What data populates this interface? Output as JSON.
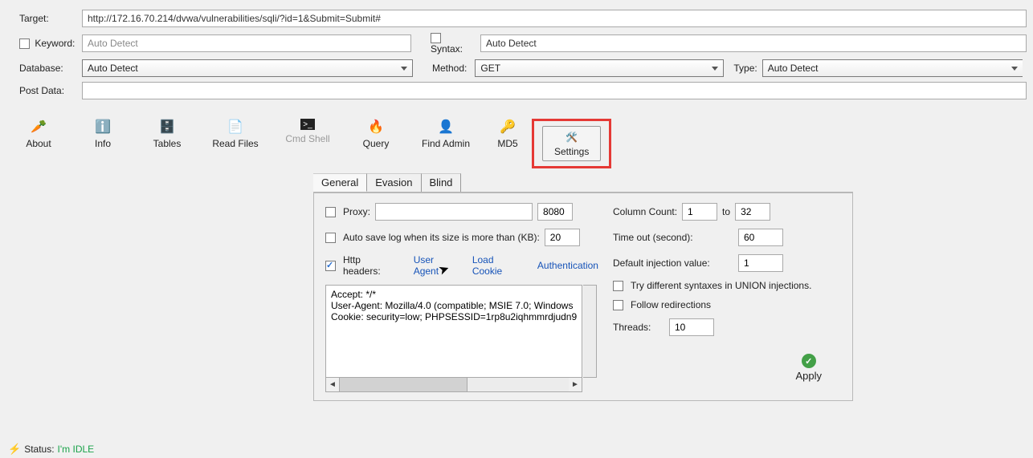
{
  "top": {
    "target_label": "Target:",
    "target_value": "http://172.16.70.214/dvwa/vulnerabilities/sqli/?id=1&Submit=Submit#",
    "keyword_label": "Keyword:",
    "keyword_value": "Auto Detect",
    "syntax_label": "Syntax:",
    "syntax_value": "Auto Detect",
    "database_label": "Database:",
    "database_value": "Auto Detect",
    "method_label": "Method:",
    "method_value": "GET",
    "type_label": "Type:",
    "type_value": "Auto Detect",
    "post_data_label": "Post Data:",
    "post_data_value": ""
  },
  "toolbar": {
    "about": "About",
    "info": "Info",
    "tables": "Tables",
    "read_files": "Read Files",
    "cmd_shell": "Cmd Shell",
    "query": "Query",
    "find_admin": "Find Admin",
    "md5": "MD5",
    "settings": "Settings"
  },
  "tabs": {
    "general": "General",
    "evasion": "Evasion",
    "blind": "Blind"
  },
  "general": {
    "proxy_label": "Proxy:",
    "proxy_host": "",
    "proxy_port": "8080",
    "autosave_label": "Auto save log when its size is more than (KB):",
    "autosave_value": "20",
    "headers_label": "Http headers:",
    "link_user_agent": "User Agent",
    "link_load_cookie": "Load Cookie",
    "link_auth": "Authentication",
    "headers_text": "Accept: */*\nUser-Agent: Mozilla/4.0 (compatible; MSIE 7.0; Windows\nCookie: security=low; PHPSESSID=1rp8u2iqhmmrdjudn9"
  },
  "right": {
    "col_count_label": "Column Count:",
    "col_from": "1",
    "col_to_label": "to",
    "col_to": "32",
    "timeout_label": "Time out (second):",
    "timeout_value": "60",
    "default_inj_label": "Default injection value:",
    "default_inj_value": "1",
    "try_syntax_label": "Try different syntaxes in UNION injections.",
    "follow_redir_label": "Follow redirections",
    "threads_label": "Threads:",
    "threads_value": "10",
    "apply_label": "Apply"
  },
  "status": {
    "label": "Status:",
    "value": "I'm IDLE"
  }
}
